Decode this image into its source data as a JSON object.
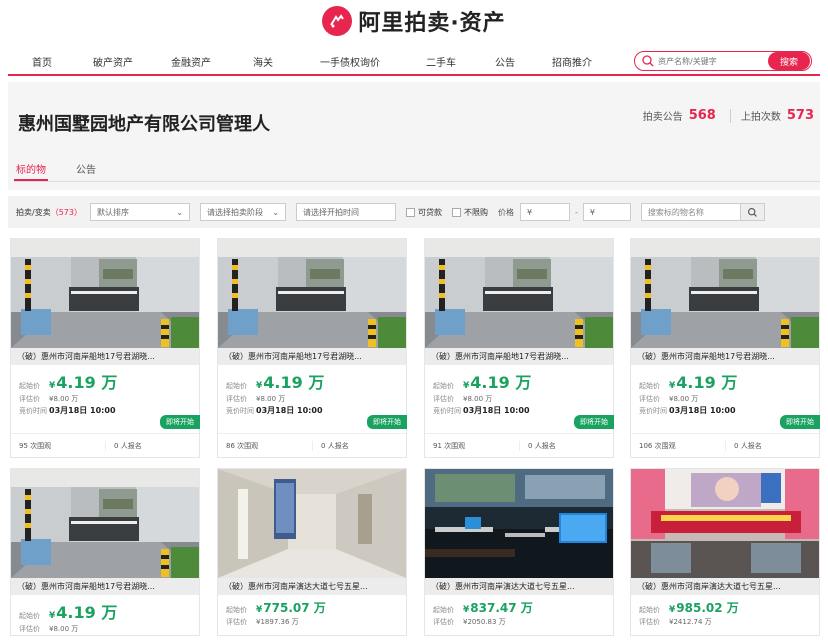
{
  "logo": {
    "text": "阿里拍卖·资产"
  },
  "nav": {
    "items": [
      "首页",
      "破产资产",
      "金融资产",
      "海关",
      "一手债权询价",
      "二手车",
      "公告",
      "招商推介"
    ],
    "search_placeholder": "资产名称/关键字",
    "search_button": "搜索"
  },
  "header": {
    "company": "惠州国墅园地产有限公司管理人",
    "stat1_label": "拍卖公告",
    "stat1_value": "568",
    "stat2_label": "上拍次数",
    "stat2_value": "573"
  },
  "tabs": [
    "标的物",
    "公告"
  ],
  "filter": {
    "label": "拍卖/变卖",
    "count": "（573）",
    "sort": "默认排序",
    "stage": "请选择拍卖阶段",
    "time": "请选择开拍时间",
    "chk1": "可贷款",
    "chk2": "不限购",
    "price_label": "价格",
    "price_min": "¥",
    "price_max": "¥",
    "dash": "-",
    "search_placeholder": "搜索标的物名称"
  },
  "labels": {
    "start": "起始价",
    "eval": "评估价",
    "time": "竞价时间",
    "views_suffix": "次围观",
    "signups_suffix": "人报名",
    "currency": "¥"
  },
  "cards": [
    {
      "title": "（破）惠州市河南岸船地17号君湖晓...",
      "price": "4.19 万",
      "eval": "¥8.00 万",
      "time": "03月18日 10:00",
      "badge": "即将开始",
      "views": "95",
      "signups": "0"
    },
    {
      "title": "（破）惠州市河南岸船地17号君湖晓...",
      "price": "4.19 万",
      "eval": "¥8.00 万",
      "time": "03月18日 10:00",
      "badge": "即将开始",
      "views": "86",
      "signups": "0"
    },
    {
      "title": "（破）惠州市河南岸船地17号君湖晓...",
      "price": "4.19 万",
      "eval": "¥8.00 万",
      "time": "03月18日 10:00",
      "badge": "即将开始",
      "views": "91",
      "signups": "0"
    },
    {
      "title": "（破）惠州市河南岸船地17号君湖晓...",
      "price": "4.19 万",
      "eval": "¥8.00 万",
      "time": "03月18日 10:00",
      "badge": "即将开始",
      "views": "106",
      "signups": "0"
    },
    {
      "title": "（破）惠州市河南岸船地17号君湖晓...",
      "price": "4.19 万",
      "eval": "¥8.00 万"
    },
    {
      "title": "（破）惠州市河南岸演达大道七号五星...",
      "price": "775.07 万",
      "eval": "¥1897.36 万"
    },
    {
      "title": "（破）惠州市河南岸演达大道七号五星...",
      "price": "837.47 万",
      "eval": "¥2050.83 万"
    },
    {
      "title": "（破）惠州市河南岸演达大道七号五星...",
      "price": "985.02 万",
      "eval": "¥2412.74 万"
    }
  ],
  "colors": {
    "accent": "#e8254f",
    "green": "#1aa260"
  }
}
